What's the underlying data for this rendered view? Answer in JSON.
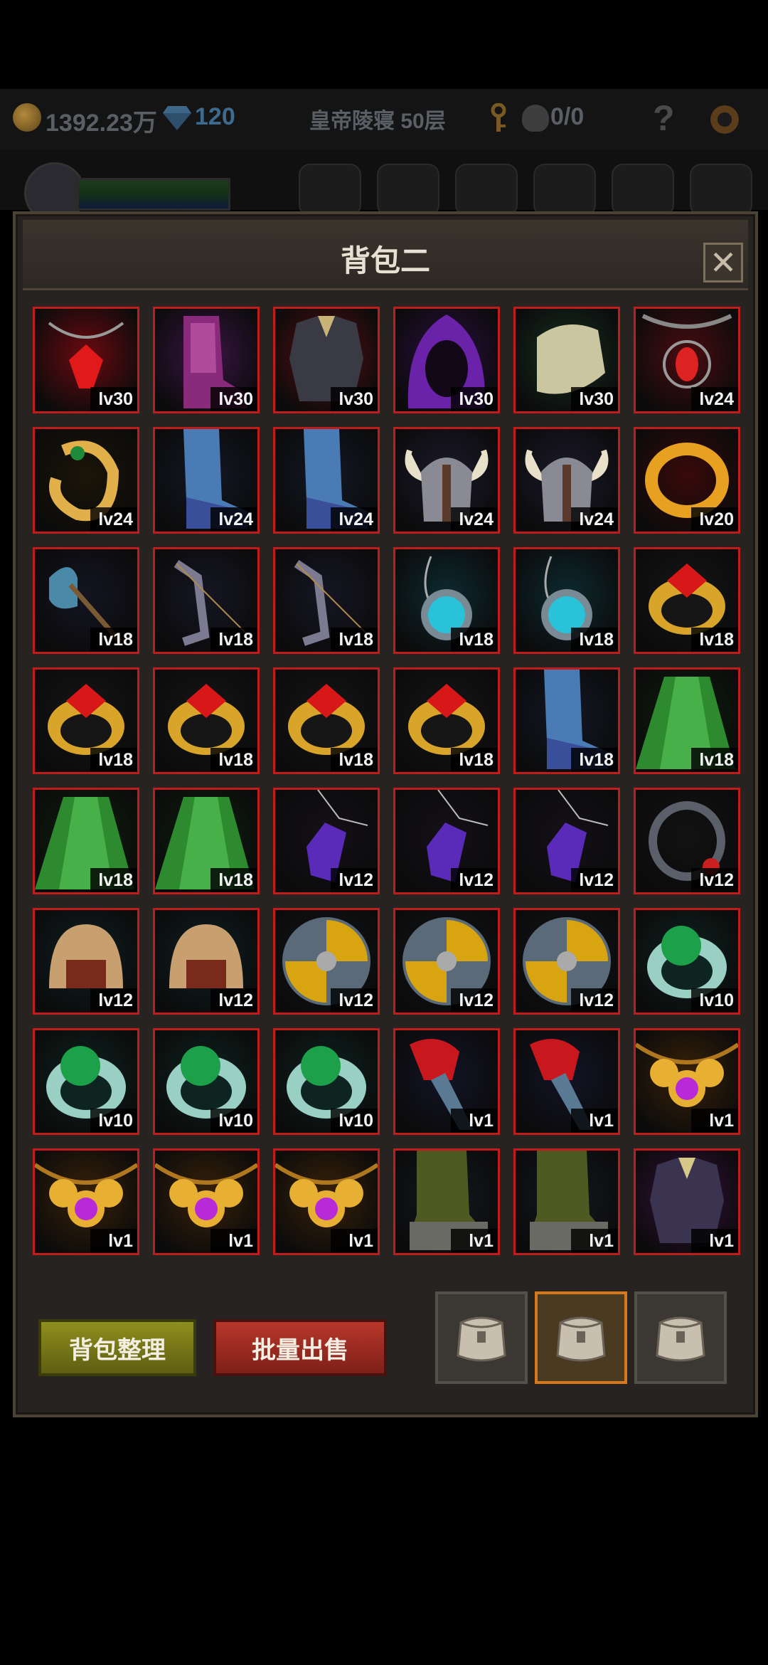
{
  "top_bar": {
    "gold": "1392.23万",
    "gems": "120",
    "floor": "皇帝陵寝 50层",
    "dead_count": "0/0",
    "help": "?"
  },
  "panel": {
    "title": "背包二",
    "close": "✕"
  },
  "items": [
    {
      "icon": "red-gem-necklace-icon",
      "level": "lv30",
      "bg": "#6b0a10"
    },
    {
      "icon": "magenta-boot-icon",
      "level": "lv30",
      "bg": "#3a1545"
    },
    {
      "icon": "dark-armor-icon",
      "level": "lv30",
      "bg": "#5a0d12"
    },
    {
      "icon": "purple-hood-icon",
      "level": "lv30",
      "bg": "#2a0f3f"
    },
    {
      "icon": "stone-shoulder-icon",
      "level": "lv30",
      "bg": "#173022"
    },
    {
      "icon": "ruby-necklace-icon",
      "level": "lv24",
      "bg": "#4a0c10"
    },
    {
      "icon": "gold-ring-green-icon",
      "level": "lv24",
      "bg": "#1a1508"
    },
    {
      "icon": "blue-boot-icon",
      "level": "lv24",
      "bg": "#141826"
    },
    {
      "icon": "blue-boot-icon",
      "level": "lv24",
      "bg": "#141826"
    },
    {
      "icon": "horned-helmet-icon",
      "level": "lv24",
      "bg": "#1b1a2c"
    },
    {
      "icon": "horned-helmet-icon",
      "level": "lv24",
      "bg": "#1b1a2c"
    },
    {
      "icon": "gold-ring-icon",
      "level": "lv20",
      "bg": "#3a0a0a"
    },
    {
      "icon": "ice-axe-icon",
      "level": "lv18",
      "bg": "#141422"
    },
    {
      "icon": "bow-icon",
      "level": "lv18",
      "bg": "#161624"
    },
    {
      "icon": "bow-icon",
      "level": "lv18",
      "bg": "#161624"
    },
    {
      "icon": "cyan-orb-amulet-icon",
      "level": "lv18",
      "bg": "#0d2a30"
    },
    {
      "icon": "cyan-orb-amulet-icon",
      "level": "lv18",
      "bg": "#0d2a30"
    },
    {
      "icon": "ruby-gold-ring-icon",
      "level": "lv18",
      "bg": "#161616"
    },
    {
      "icon": "ruby-gold-ring-icon",
      "level": "lv18",
      "bg": "#161616"
    },
    {
      "icon": "ruby-gold-ring-icon",
      "level": "lv18",
      "bg": "#161616"
    },
    {
      "icon": "ruby-gold-ring-icon",
      "level": "lv18",
      "bg": "#161616"
    },
    {
      "icon": "ruby-gold-ring-icon",
      "level": "lv18",
      "bg": "#161616"
    },
    {
      "icon": "blue-boot-icon",
      "level": "lv18",
      "bg": "#141826"
    },
    {
      "icon": "green-cloak-icon",
      "level": "lv18",
      "bg": "#0e1f0e"
    },
    {
      "icon": "green-cloak-icon",
      "level": "lv18",
      "bg": "#0e1f0e"
    },
    {
      "icon": "green-cloak-icon",
      "level": "lv18",
      "bg": "#0e1f0e"
    },
    {
      "icon": "purple-crystal-pendant-icon",
      "level": "lv12",
      "bg": "#141018"
    },
    {
      "icon": "purple-crystal-pendant-icon",
      "level": "lv12",
      "bg": "#141018"
    },
    {
      "icon": "purple-crystal-pendant-icon",
      "level": "lv12",
      "bg": "#141018"
    },
    {
      "icon": "silver-ring-icon",
      "level": "lv12",
      "bg": "#121212"
    },
    {
      "icon": "bronze-helmet-icon",
      "level": "lv12",
      "bg": "#0f2024"
    },
    {
      "icon": "bronze-helmet-icon",
      "level": "lv12",
      "bg": "#0f2024"
    },
    {
      "icon": "round-shield-icon",
      "level": "lv12",
      "bg": "#121418"
    },
    {
      "icon": "round-shield-icon",
      "level": "lv12",
      "bg": "#121418"
    },
    {
      "icon": "round-shield-icon",
      "level": "lv12",
      "bg": "#121418"
    },
    {
      "icon": "emerald-ring-icon",
      "level": "lv10",
      "bg": "#0d2420"
    },
    {
      "icon": "emerald-ring-icon",
      "level": "lv10",
      "bg": "#0d2420"
    },
    {
      "icon": "emerald-ring-icon",
      "level": "lv10",
      "bg": "#0d2420"
    },
    {
      "icon": "emerald-ring-icon",
      "level": "lv10",
      "bg": "#0d2420"
    },
    {
      "icon": "red-gauntlet-icon",
      "level": "lv1",
      "bg": "#121426"
    },
    {
      "icon": "red-gauntlet-icon",
      "level": "lv1",
      "bg": "#121426"
    },
    {
      "icon": "amethyst-necklace-icon",
      "level": "lv1",
      "bg": "#3a2208"
    },
    {
      "icon": "amethyst-necklace-icon",
      "level": "lv1",
      "bg": "#3a2208"
    },
    {
      "icon": "amethyst-necklace-icon",
      "level": "lv1",
      "bg": "#3a2208"
    },
    {
      "icon": "amethyst-necklace-icon",
      "level": "lv1",
      "bg": "#3a2208"
    },
    {
      "icon": "olive-greave-icon",
      "level": "lv1",
      "bg": "#141820"
    },
    {
      "icon": "olive-greave-icon",
      "level": "lv1",
      "bg": "#141820"
    },
    {
      "icon": "purple-chest-armor-icon",
      "level": "lv1",
      "bg": "#3a1040"
    }
  ],
  "buttons": {
    "sort": "背包整理",
    "sell": "批量出售"
  },
  "bag_tabs": [
    {
      "active": false
    },
    {
      "active": true
    },
    {
      "active": false
    }
  ]
}
